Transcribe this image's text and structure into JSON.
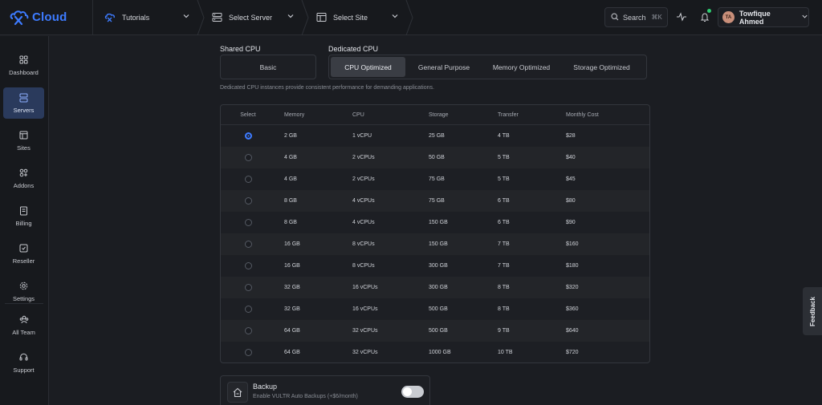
{
  "brand": {
    "name": "Cloud",
    "accent": "#3d7bff"
  },
  "topbar": {
    "crumbs": [
      {
        "label": "Tutorials",
        "icon": "tutorials-logo-icon"
      },
      {
        "label": "Select Server",
        "icon": "server-icon"
      },
      {
        "label": "Select Site",
        "icon": "site-icon"
      }
    ],
    "search": {
      "label": "Search",
      "shortcut": "⌘K"
    },
    "user": {
      "name": "Towfique Ahmed",
      "initials": "TA"
    }
  },
  "sidebar": {
    "items": [
      {
        "label": "Dashboard",
        "icon": "dashboard-icon"
      },
      {
        "label": "Servers",
        "icon": "servers-icon",
        "active": true
      },
      {
        "label": "Sites",
        "icon": "sites-icon"
      },
      {
        "label": "Addons",
        "icon": "addons-icon"
      },
      {
        "label": "Billing",
        "icon": "billing-icon"
      },
      {
        "label": "Reseller",
        "icon": "reseller-icon"
      },
      {
        "label": "Settings",
        "icon": "settings-icon"
      },
      {
        "label": "All Team",
        "icon": "team-icon"
      },
      {
        "label": "Support",
        "icon": "support-icon"
      }
    ]
  },
  "cpu": {
    "shared_label": "Shared CPU",
    "shared_option": "Basic",
    "dedicated_label": "Dedicated CPU",
    "dedicated_tabs": [
      "CPU Optimized",
      "General Purpose",
      "Memory Optimized",
      "Storage Optimized"
    ],
    "active_tab": "CPU Optimized",
    "description": "Dedicated CPU instances provide consistent performance for demanding applications."
  },
  "plans": {
    "columns": [
      "Select",
      "Memory",
      "CPU",
      "Storage",
      "Transfer",
      "Monthly Cost"
    ],
    "selected_index": 0,
    "rows": [
      [
        "2 GB",
        "1 vCPU",
        "25 GB",
        "4 TB",
        "$28"
      ],
      [
        "4 GB",
        "2 vCPUs",
        "50 GB",
        "5 TB",
        "$40"
      ],
      [
        "4 GB",
        "2 vCPUs",
        "75 GB",
        "5 TB",
        "$45"
      ],
      [
        "8 GB",
        "4 vCPUs",
        "75 GB",
        "6 TB",
        "$80"
      ],
      [
        "8 GB",
        "4 vCPUs",
        "150 GB",
        "6 TB",
        "$90"
      ],
      [
        "16 GB",
        "8 vCPUs",
        "150 GB",
        "7 TB",
        "$160"
      ],
      [
        "16 GB",
        "8 vCPUs",
        "300 GB",
        "7 TB",
        "$180"
      ],
      [
        "32 GB",
        "16 vCPUs",
        "300 GB",
        "8 TB",
        "$320"
      ],
      [
        "32 GB",
        "16 vCPUs",
        "500 GB",
        "8 TB",
        "$360"
      ],
      [
        "64 GB",
        "32 vCPUs",
        "500 GB",
        "9 TB",
        "$640"
      ],
      [
        "64 GB",
        "32 vCPUs",
        "1000 GB",
        "10 TB",
        "$720"
      ]
    ]
  },
  "backup": {
    "title": "Backup",
    "description": "Enable VULTR Auto Backups (+$6/month)",
    "enabled": false
  },
  "feedback_label": "Feedback"
}
